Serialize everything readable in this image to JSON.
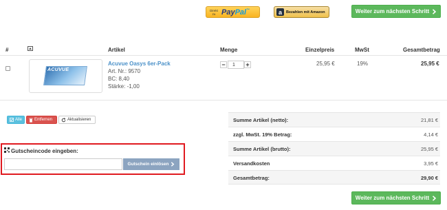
{
  "top_buttons": {
    "paypal_small": "Direkt zu",
    "paypal_word_1": "Pay",
    "paypal_word_2": "Pal",
    "paypal_tm": "™",
    "amazon_label": "Bezahlen mit Amazon",
    "amazon_logo": "a",
    "next_step": "Weiter zum nächsten Schritt",
    "next_icon": "chevron-right-icon"
  },
  "table": {
    "headers": {
      "index": "#",
      "image_icon": "image-icon",
      "article": "Artikel",
      "quantity": "Menge",
      "unit_price": "Einzelpreis",
      "vat": "MwSt",
      "total": "Gesamtbetrag"
    },
    "rows": [
      {
        "name": "Acuvue Oasys 6er-Pack",
        "art_nr": "Art. Nr.: 9570",
        "bc": "BC: 8,40",
        "strength": "Stärke: -1,00",
        "quantity": "1",
        "unit_price": "25,95 €",
        "vat": "19%",
        "total": "25,95 €",
        "image_brand": "ACUVUE"
      }
    ],
    "qty_minus": "−",
    "qty_plus": "+"
  },
  "actions": {
    "all_label": "Alle",
    "remove_label": "Entfernen",
    "update_label": "Aktualisieren"
  },
  "summary": [
    {
      "label": "Summe Artikel (netto):",
      "value": "21,81 €"
    },
    {
      "label": "zzgl. MwSt. 19% Betrag:",
      "value": "4,14 €"
    },
    {
      "label": "Summe Artikel (brutto):",
      "value": "25,95 €"
    },
    {
      "label": "Versandkosten",
      "value": "3,95 €"
    },
    {
      "label": "Gesamtbetrag:",
      "value": "29,90 €"
    }
  ],
  "coupon": {
    "title": "Gutscheincode eingeben:",
    "placeholder": "",
    "button": "Gutschein einlösen"
  },
  "colors": {
    "green": "#5cb85c",
    "link_blue": "#4a90c8",
    "highlight_red": "#e0191f",
    "coupon_button": "#8ca4c0"
  }
}
